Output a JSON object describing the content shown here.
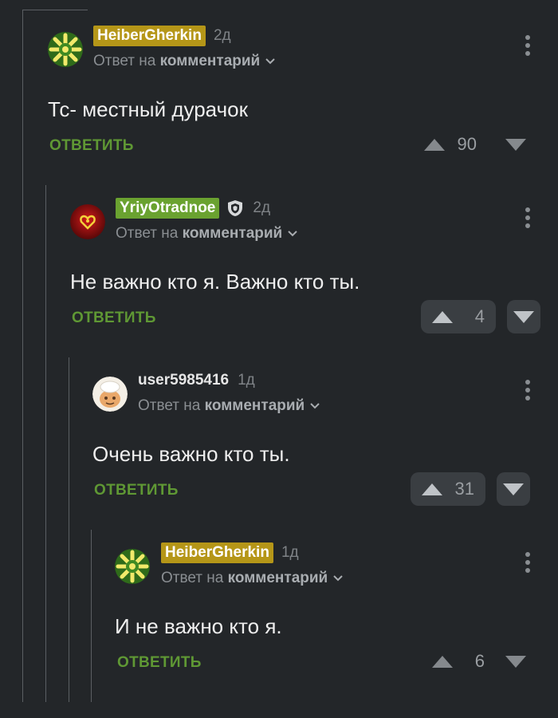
{
  "comments": [
    {
      "username": "HeiberGherkin",
      "time": "2д",
      "reply_prefix": "Ответ на",
      "reply_link": "комментарий",
      "text": "Тс- местный дурачок",
      "reply_label": "ОТВЕТИТЬ",
      "votes": "90"
    },
    {
      "username": "YriyOtradnoe",
      "time": "2д",
      "reply_prefix": "Ответ на",
      "reply_link": "комментарий",
      "text": "Не важно кто я. Важно кто ты.",
      "reply_label": "ОТВЕТИТЬ",
      "votes": "4"
    },
    {
      "username": "user5985416",
      "time": "1д",
      "reply_prefix": "Ответ на",
      "reply_link": "комментарий",
      "text": "Очень важно кто ты.",
      "reply_label": "ОТВЕТИТЬ",
      "votes": "31"
    },
    {
      "username": "HeiberGherkin",
      "time": "1д",
      "reply_prefix": "Ответ на",
      "reply_link": "комментарий",
      "text": "И не важно кто я.",
      "reply_label": "ОТВЕТИТЬ",
      "votes": "6"
    }
  ],
  "colors": {
    "background": "#232629",
    "reply_green": "#5f9834",
    "username_gold": "#b59618",
    "username_green": "#6aa230"
  },
  "icons": {
    "avatar_1": "gherkin-avatar-icon",
    "avatar_2": "red-heart-avatar-icon",
    "avatar_3": "cartoon-face-avatar-icon",
    "avatar_4": "gherkin-avatar-icon",
    "badge_2": "shield-icon",
    "menu": "kebab-menu-icon"
  }
}
